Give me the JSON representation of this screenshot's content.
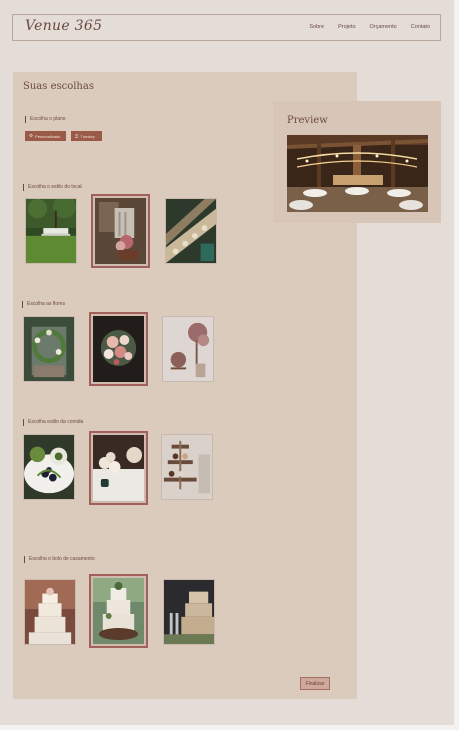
{
  "nav": {
    "logo": "Venue 365",
    "links": [
      "Sobre",
      "Projeto",
      "Orçamento",
      "Contato"
    ]
  },
  "main": {
    "title": "Suas escolhas",
    "plan": {
      "label": "Escolha o plano",
      "options": [
        {
          "icon": "personalize-icon",
          "label": "Personalizado"
        },
        {
          "icon": "turnkey-icon",
          "label": "Turnkey"
        }
      ]
    },
    "sections": [
      {
        "label": "Escolha o estilo do local",
        "selected_index": 1
      },
      {
        "label": "Escolha as flores",
        "selected_index": 1
      },
      {
        "label": "Escolha estilo da comida",
        "selected_index": 1
      },
      {
        "label": "Escolha o bolo de casamento",
        "selected_index": 1
      }
    ],
    "finish_label": "Finalizar"
  },
  "preview": {
    "title": "Preview"
  },
  "colors": {
    "background": "#e4dcd7",
    "panel": "#dacbbd",
    "accent": "#9b5a48",
    "selected_border": "#a1605a"
  }
}
